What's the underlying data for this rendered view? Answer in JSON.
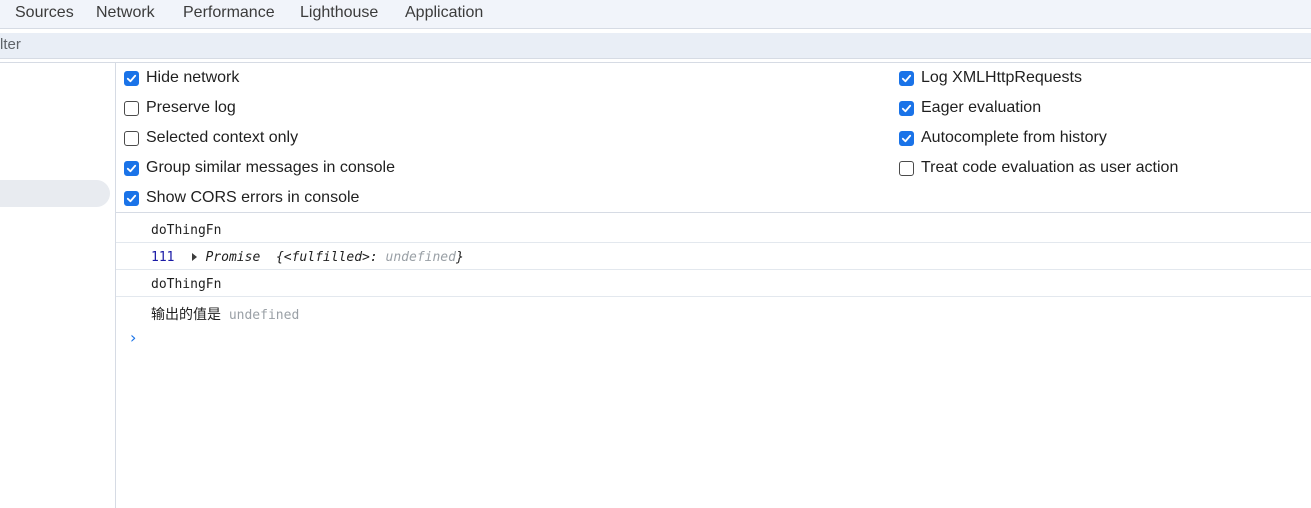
{
  "tabs": [
    "Sources",
    "Network",
    "Performance",
    "Lighthouse",
    "Application"
  ],
  "filter": {
    "text": "lter"
  },
  "settings": {
    "left": [
      {
        "label": "Hide network",
        "checked": true
      },
      {
        "label": "Preserve log",
        "checked": false
      },
      {
        "label": "Selected context only",
        "checked": false
      },
      {
        "label": "Group similar messages in console",
        "checked": true
      },
      {
        "label": "Show CORS errors in console",
        "checked": true
      }
    ],
    "right": [
      {
        "label": "Log XMLHttpRequests",
        "checked": true
      },
      {
        "label": "Eager evaluation",
        "checked": true
      },
      {
        "label": "Autocomplete from history",
        "checked": true
      },
      {
        "label": "Treat code evaluation as user action",
        "checked": false
      }
    ]
  },
  "console": {
    "line1": "doThingFn",
    "line2": {
      "number": "111",
      "type": "Promise",
      "state": "{<fulfilled>: ",
      "value": "undefined",
      "close": "}"
    },
    "line3": "doThingFn",
    "line4": {
      "label": "输出的值是",
      "value": "undefined"
    },
    "prompt": "›"
  },
  "colors": {
    "accent": "#1a73e8",
    "tabbar_bg": "#f1f4fa",
    "filterbar_bg": "#e9eef6"
  }
}
